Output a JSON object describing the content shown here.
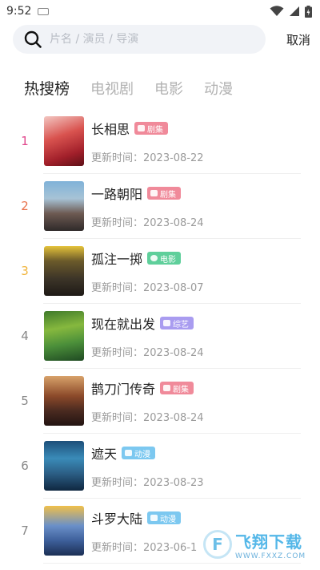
{
  "status_bar": {
    "time": "9:52"
  },
  "search": {
    "placeholder": "片名 / 演员 / 导演",
    "cancel_label": "取消"
  },
  "tabs": [
    {
      "label": "热搜榜",
      "active": true
    },
    {
      "label": "电视剧",
      "active": false
    },
    {
      "label": "电影",
      "active": false
    },
    {
      "label": "动漫",
      "active": false
    }
  ],
  "colors": {
    "rank_1": "#e0468c",
    "rank_2": "#e8724c",
    "rank_3": "#f0b43c",
    "rank_other": "#888888",
    "tag_drama": "#f08a9a",
    "tag_movie": "#5fcf9b",
    "tag_variety": "#a99cf0",
    "tag_anime": "#7cc8f0"
  },
  "update_label": "更新时间：",
  "items": [
    {
      "rank": "1",
      "title": "长相思",
      "tag": "剧集",
      "tag_icon": "tv-icon",
      "date": "2023-08-22"
    },
    {
      "rank": "2",
      "title": "一路朝阳",
      "tag": "剧集",
      "tag_icon": "tv-icon",
      "date": "2023-08-24"
    },
    {
      "rank": "3",
      "title": "孤注一掷",
      "tag": "电影",
      "tag_icon": "film-reel-icon",
      "date": "2023-08-07"
    },
    {
      "rank": "4",
      "title": "现在就出发",
      "tag": "综艺",
      "tag_icon": "star-icon",
      "date": "2023-08-24"
    },
    {
      "rank": "5",
      "title": "鹊刀门传奇",
      "tag": "剧集",
      "tag_icon": "tv-icon",
      "date": "2023-08-24"
    },
    {
      "rank": "6",
      "title": "遮天",
      "tag": "动漫",
      "tag_icon": "cat-icon",
      "date": "2023-08-23"
    },
    {
      "rank": "7",
      "title": "斗罗大陆",
      "tag": "动漫",
      "tag_icon": "cat-icon",
      "date": "2023-06-1"
    }
  ],
  "watermark": {
    "logo_text": "飞翔下载",
    "url": "WWW.FXXZ.COM"
  }
}
